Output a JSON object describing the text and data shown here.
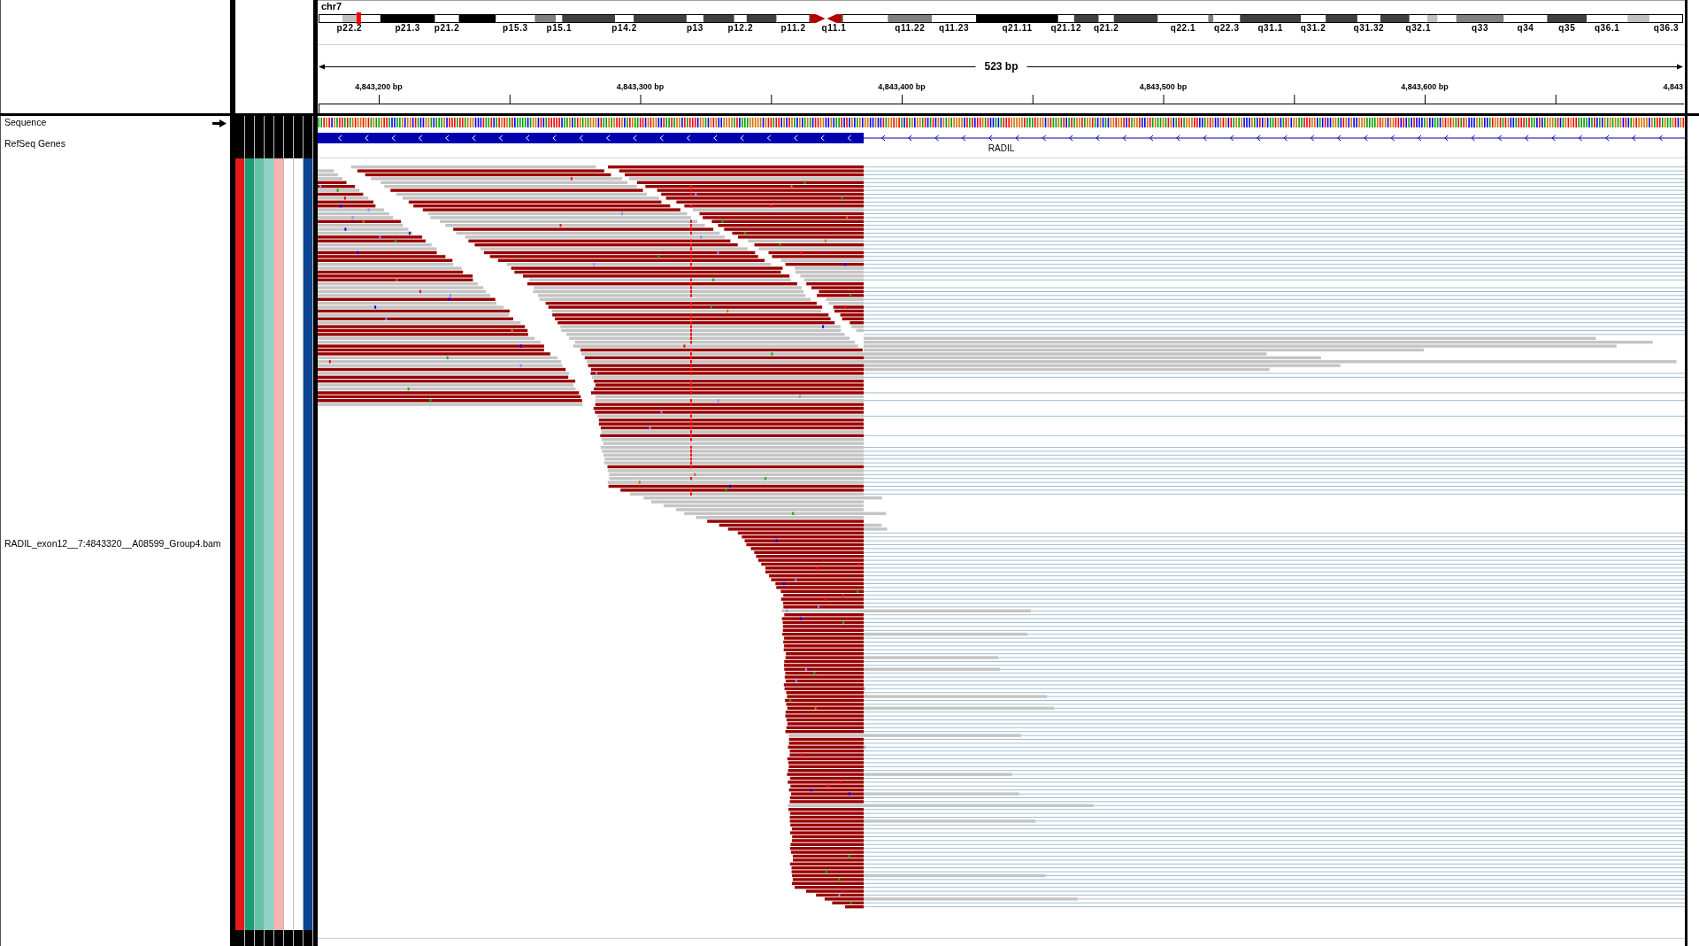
{
  "header": {
    "chromosome": "chr7",
    "ideogram": {
      "bands": [
        {
          "kind": "gneg",
          "selected": false
        },
        {
          "kind": "gpos25",
          "label": "p22.2",
          "selected": false
        },
        {
          "kind": "gneg",
          "selected": true
        },
        {
          "kind": "gpos100",
          "label": "p21.3",
          "selected": false
        },
        {
          "kind": "gneg",
          "label": "p21.2",
          "selected": false
        },
        {
          "kind": "gpos100",
          "selected": false
        },
        {
          "kind": "gneg",
          "label": "p15.3",
          "selected": false
        },
        {
          "kind": "gpos50",
          "selected": false
        },
        {
          "kind": "gneg",
          "label": "p15.1",
          "selected": false
        },
        {
          "kind": "gpos75",
          "selected": false
        },
        {
          "kind": "gneg",
          "label": "p14.2",
          "selected": false
        },
        {
          "kind": "gpos75",
          "selected": false
        },
        {
          "kind": "gneg",
          "label": "p13",
          "selected": false
        },
        {
          "kind": "gpos75",
          "selected": false
        },
        {
          "kind": "gneg",
          "label": "p12.2",
          "selected": false
        },
        {
          "kind": "gpos75",
          "selected": false
        },
        {
          "kind": "gneg",
          "label": "p11.2",
          "selected": false
        },
        {
          "kind": "acen",
          "selected": false
        },
        {
          "kind": "acen",
          "label": "q11.1",
          "selected": false
        },
        {
          "kind": "gneg",
          "selected": false
        },
        {
          "kind": "gpos50",
          "label": "q11.22",
          "selected": false
        },
        {
          "kind": "gneg",
          "label": "q11.23",
          "selected": false
        },
        {
          "kind": "gpos100",
          "label": "q21.11",
          "selected": false
        },
        {
          "kind": "gneg",
          "label": "q21.12",
          "selected": false
        },
        {
          "kind": "gpos75",
          "selected": false
        },
        {
          "kind": "gneg",
          "label": "q21.2",
          "selected": false
        },
        {
          "kind": "gpos75",
          "selected": false
        },
        {
          "kind": "gneg",
          "label": "q22.1",
          "selected": false
        },
        {
          "kind": "gpos50",
          "selected": false
        },
        {
          "kind": "gneg",
          "label": "q22.3",
          "selected": false
        },
        {
          "kind": "gpos75",
          "label": "q31.1",
          "selected": false
        },
        {
          "kind": "gneg",
          "label": "q31.2",
          "selected": false
        },
        {
          "kind": "gpos75",
          "selected": false
        },
        {
          "kind": "gneg",
          "label": "q31.32",
          "selected": false
        },
        {
          "kind": "gpos75",
          "selected": false
        },
        {
          "kind": "gneg",
          "label": "q32.1",
          "selected": false
        },
        {
          "kind": "gpos25",
          "selected": false
        },
        {
          "kind": "gneg",
          "selected": false
        },
        {
          "kind": "gpos50",
          "label": "q33",
          "selected": false
        },
        {
          "kind": "gneg",
          "label": "q34",
          "selected": false
        },
        {
          "kind": "gpos75",
          "label": "q35",
          "selected": false
        },
        {
          "kind": "gneg",
          "label": "q36.1",
          "selected": false
        },
        {
          "kind": "gpos25",
          "selected": false
        },
        {
          "kind": "gneg",
          "label": "q36.3",
          "selected": false
        }
      ]
    },
    "ruler": {
      "span": "523 bp",
      "ticks": [
        "4,843,200 bp",
        "4,843,300 bp",
        "4,843,400 bp",
        "4,843,500 bp",
        "4,843,600 bp",
        "4,843"
      ]
    }
  },
  "tracks": [
    {
      "kind": "sequence",
      "name": "Sequence",
      "reversed": false
    },
    {
      "kind": "genes",
      "name": "RefSeq Genes",
      "genes": [
        {
          "name": "RADIL",
          "reverse_strand": true
        }
      ]
    },
    {
      "kind": "alignments",
      "name": "RADIL_exon12__7:4843320__A08599_Group4.bam",
      "attributes": [
        {
          "color": "#e41a1c"
        },
        {
          "color": "#1b9e77"
        },
        {
          "color": "#66c2a5"
        },
        {
          "color": "#8dd3c7"
        },
        {
          "color": "#fbb4ae"
        },
        {
          "color": "#ffffff"
        },
        {
          "color": "#ffffff"
        },
        {
          "color": "#0c4594"
        }
      ]
    }
  ]
}
